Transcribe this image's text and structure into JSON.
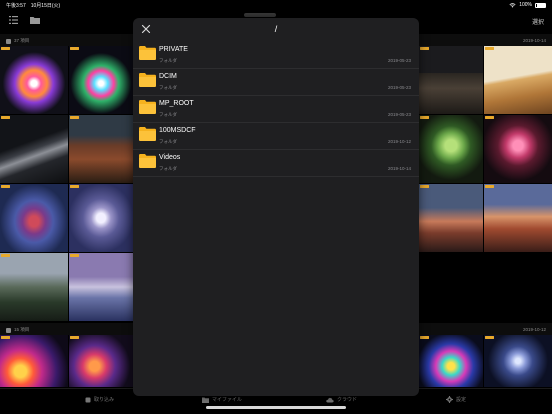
{
  "status": {
    "time_date": "午後3:57　10月15日(火)",
    "battery": "100%"
  },
  "nav": {
    "select_label": "選択"
  },
  "sections": [
    {
      "label": "37 項目",
      "date": "2019-10-14"
    },
    {
      "label": "15 項目",
      "date": "2019-10-12"
    }
  ],
  "modal": {
    "title": "/",
    "items": [
      {
        "name": "PRIVATE",
        "kind": "フォルダ",
        "date": "2019-05-23"
      },
      {
        "name": "DCIM",
        "kind": "フォルダ",
        "date": "2019-05-23"
      },
      {
        "name": "MP_ROOT",
        "kind": "フォルダ",
        "date": "2019-05-23"
      },
      {
        "name": "100MSDCF",
        "kind": "フォルダ",
        "date": "2019-10-12"
      },
      {
        "name": "Videos",
        "kind": "フォルダ",
        "date": "2019-10-14"
      }
    ]
  },
  "tabs": [
    {
      "label": "取り込み",
      "icon": "import-icon"
    },
    {
      "label": "マイファイル",
      "icon": "folder-icon"
    },
    {
      "label": "クラウド",
      "icon": "cloud-icon"
    },
    {
      "label": "設定",
      "icon": "gear-icon"
    }
  ],
  "colors": {
    "accent": "#e8a92c",
    "modal_bg": "#1f1f21",
    "folder": "#f6b21e"
  }
}
